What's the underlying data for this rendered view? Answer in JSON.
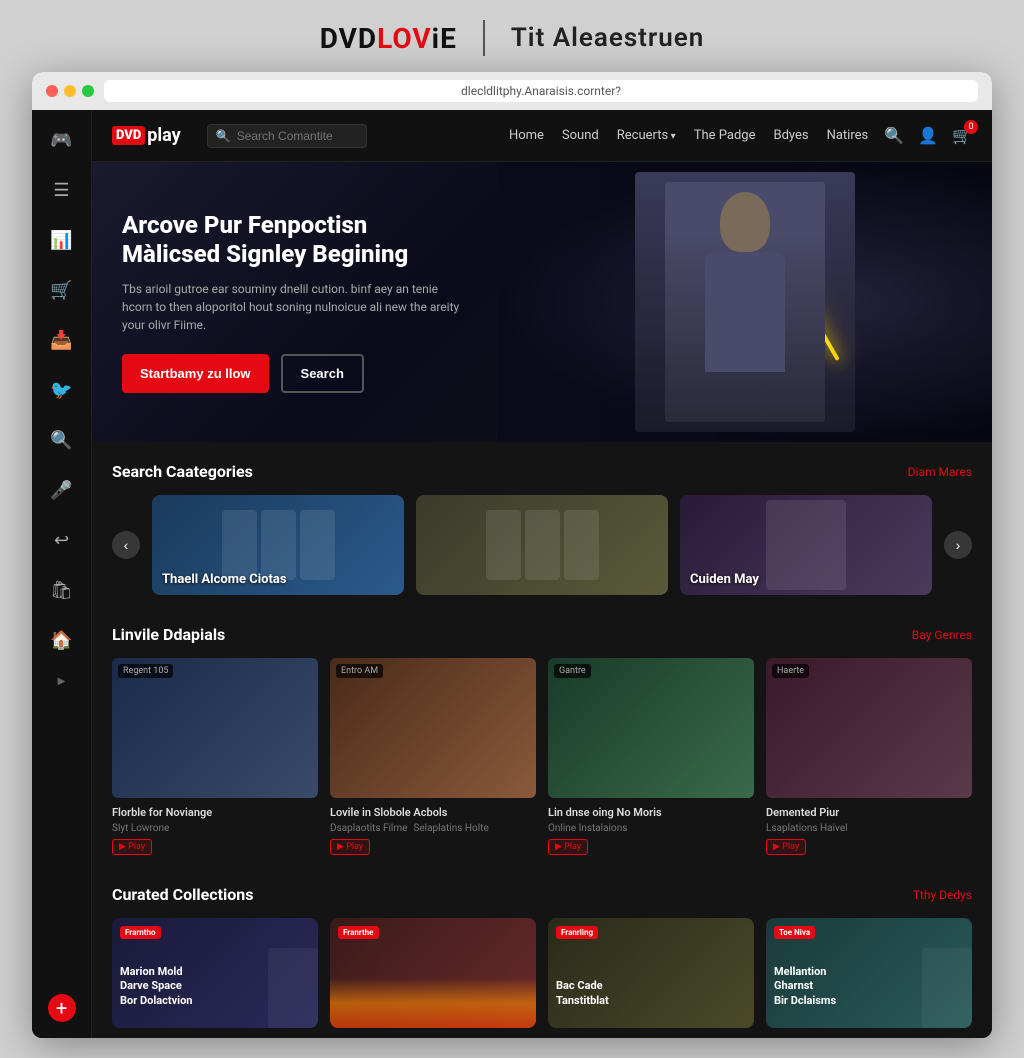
{
  "watermark": {
    "dvd_text": "DVD",
    "love_text": "LOV",
    "ie_text": "iE",
    "sub_text": "Tit Aleaestruen"
  },
  "browser": {
    "address": "dlecldlitphy.Anaraisis.cornter?"
  },
  "logo": {
    "dvd": "DVD",
    "play": "play"
  },
  "nav": {
    "search_placeholder": "Search Comantite",
    "links": [
      {
        "label": "Home",
        "dropdown": false
      },
      {
        "label": "Sound",
        "dropdown": false
      },
      {
        "label": "Recuerts",
        "dropdown": true
      },
      {
        "label": "The Padge",
        "dropdown": false
      },
      {
        "label": "Bdyes",
        "dropdown": false
      },
      {
        "label": "Natires",
        "dropdown": false
      }
    ],
    "cart_badge": "0"
  },
  "hero": {
    "title": "Arcove Pur Fenpoctisn\nMàlicsed Signley Begining",
    "description": "Tbs arioil gutroe ear souminy dnelil cution. binf aey an tenie hcorn to then aloporitol hout soning nulnoicue ali new the areity your olivr Fiime.",
    "btn_primary": "Startbamy zu llow",
    "btn_secondary": "Search"
  },
  "sections": {
    "categories": {
      "title": "Search Caategories",
      "link": "Diam Mares",
      "items": [
        {
          "label": "Thaell Alcome Ciotas",
          "color_class": "cat1"
        },
        {
          "label": "",
          "color_class": "cat2"
        },
        {
          "label": "Cuiden May",
          "color_class": "cat3"
        }
      ]
    },
    "new_releases": {
      "title": "Linvile Ddapials",
      "link": "Bay Genres",
      "movies": [
        {
          "title": "Florble for Noviange",
          "genre": "Regent 105",
          "meta1": "Slyt Lowrone",
          "meta2": "",
          "poster_class": "poster1"
        },
        {
          "title": "Lovile in Slobole Acbols",
          "genre": "Entro AM",
          "meta1": "Dsaplaotits Filme",
          "meta2": "Selaplatins Holte",
          "poster_class": "poster2"
        },
        {
          "title": "Lin dnse oing No Moris",
          "genre": "Gantre",
          "meta1": "Online Instalaions",
          "meta2": "",
          "poster_class": "poster3"
        },
        {
          "title": "Demented Piur",
          "genre": "Haerte",
          "meta1": "Lsaplations Haivel",
          "meta2": "",
          "poster_class": "poster4"
        }
      ]
    },
    "collections": {
      "title": "Curated Collections",
      "link": "Tthy Dedys",
      "items": [
        {
          "badge": "Frarntho",
          "title": "Marion Mold\nDarve Space\nBor Dolactvion",
          "sub": "",
          "color_class": "coll1"
        },
        {
          "badge": "Franrthe",
          "title": "",
          "sub": "",
          "color_class": "coll2"
        },
        {
          "badge": "Franrling",
          "title": "Bac Cade\nTanstitblat",
          "sub": "",
          "color_class": "coll3"
        },
        {
          "badge": "Toe Niva",
          "title": "Mellantion\nGharnst\nBir Dclaisms",
          "sub": "",
          "color_class": "coll4"
        }
      ]
    }
  },
  "sidebar": {
    "icons": [
      "🎮",
      "☰",
      "📊",
      "🛒",
      "📥",
      "🐦",
      "🔍",
      "🎤",
      "↩",
      "🛍",
      "🏠"
    ]
  }
}
